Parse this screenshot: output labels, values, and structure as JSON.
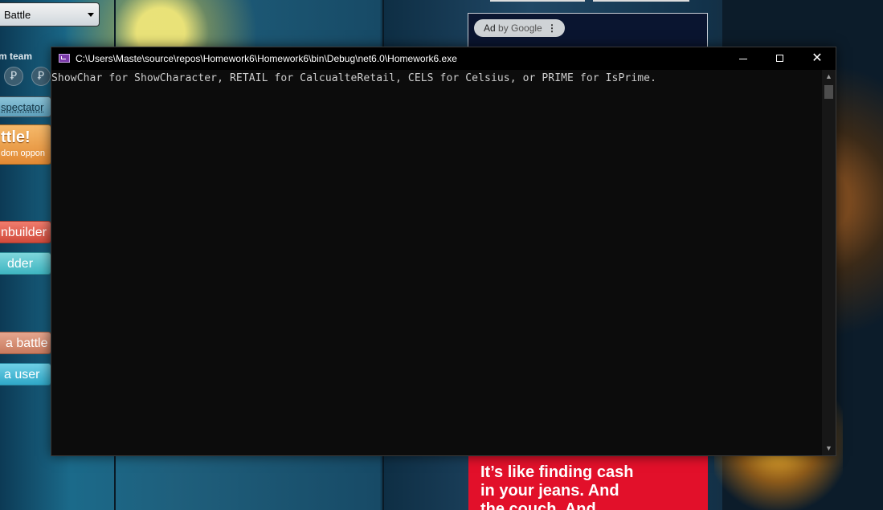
{
  "background_page": {
    "battle_select": {
      "value": "Battle"
    },
    "team_label": "m team",
    "buttons": {
      "spectator": "spectator",
      "battle_big": "ttle!",
      "battle_small": "dom oppon",
      "teambuilder": "nbuilder",
      "ladder": "dder",
      "watch_battle": "a battle",
      "find_user": "a user"
    },
    "ad": {
      "chip_label": "Ad",
      "chip_by": "by Google",
      "chip_menu": "⋮",
      "bottom_lines": [
        "It’s like finding cash",
        "in your jeans. And",
        "the couch. And"
      ]
    }
  },
  "console": {
    "title": "C:\\Users\\Maste\\source\\repos\\Homework6\\Homework6\\bin\\Debug\\net6.0\\Homework6.exe",
    "output_line": "ShowChar for ShowCharacter, RETAIL for CalcualteRetail, CELS for Celsius, or PRIME for IsPrime.",
    "controls": {
      "close_glyph": "✕",
      "scroll_up_glyph": "▲",
      "scroll_down_glyph": "▼"
    }
  },
  "colors": {
    "console_bg": "#0c0c0c",
    "console_text": "#cccccc",
    "titlebar": "#000000",
    "ad_red": "#e2102a"
  }
}
